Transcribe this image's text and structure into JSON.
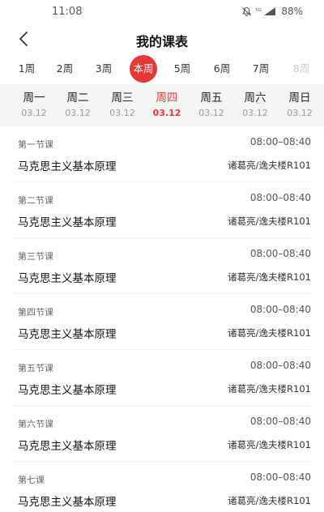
{
  "status": {
    "time": "11:08",
    "signal_label": "5G",
    "battery": "88%"
  },
  "nav": {
    "back_icon": "chevron-left-icon",
    "title": "我的课表"
  },
  "weeks": [
    {
      "label": "1周"
    },
    {
      "label": "2周"
    },
    {
      "label": "3周"
    },
    {
      "label": "本周"
    },
    {
      "label": "5周"
    },
    {
      "label": "6周"
    },
    {
      "label": "7周"
    },
    {
      "label": "8周"
    }
  ],
  "days": [
    {
      "name": "周一",
      "date": "03.12"
    },
    {
      "name": "周二",
      "date": "03.12"
    },
    {
      "name": "周三",
      "date": "03.12"
    },
    {
      "name": "周四",
      "date": "03.12"
    },
    {
      "name": "周五",
      "date": "03.12"
    },
    {
      "name": "周六",
      "date": "03.12"
    },
    {
      "name": "周日",
      "date": "03.12"
    }
  ],
  "lessons": [
    {
      "period": "第一节课",
      "time": "08:00–08:40",
      "course": "马克思主义基本原理",
      "teacher_room": "诸葛亮/逸夫楼R101"
    },
    {
      "period": "第二节课",
      "time": "08:00–08:40",
      "course": "马克思主义基本原理",
      "teacher_room": "诸葛亮/逸夫楼R101"
    },
    {
      "period": "第三节课",
      "time": "08:00–08:40",
      "course": "马克思主义基本原理",
      "teacher_room": "诸葛亮/逸夫楼R101"
    },
    {
      "period": "第四节课",
      "time": "08:00–08:40",
      "course": "马克思主义基本原理",
      "teacher_room": "诸葛亮/逸夫楼R101"
    },
    {
      "period": "第五节课",
      "time": "08:00–08:40",
      "course": "马克思主义基本原理",
      "teacher_room": "诸葛亮/逸夫楼R101"
    },
    {
      "period": "第六节课",
      "time": "08:00–08:40",
      "course": "马克思主义基本原理",
      "teacher_room": "诸葛亮/逸夫楼R101"
    },
    {
      "period": "第七课",
      "time": "08:00–08:40",
      "course": "马克思主义基本原理",
      "teacher_room": "诸葛亮/逸夫楼R101"
    }
  ],
  "colors": {
    "accent": "#e53935",
    "day_row_bg": "#f4f4f4"
  }
}
